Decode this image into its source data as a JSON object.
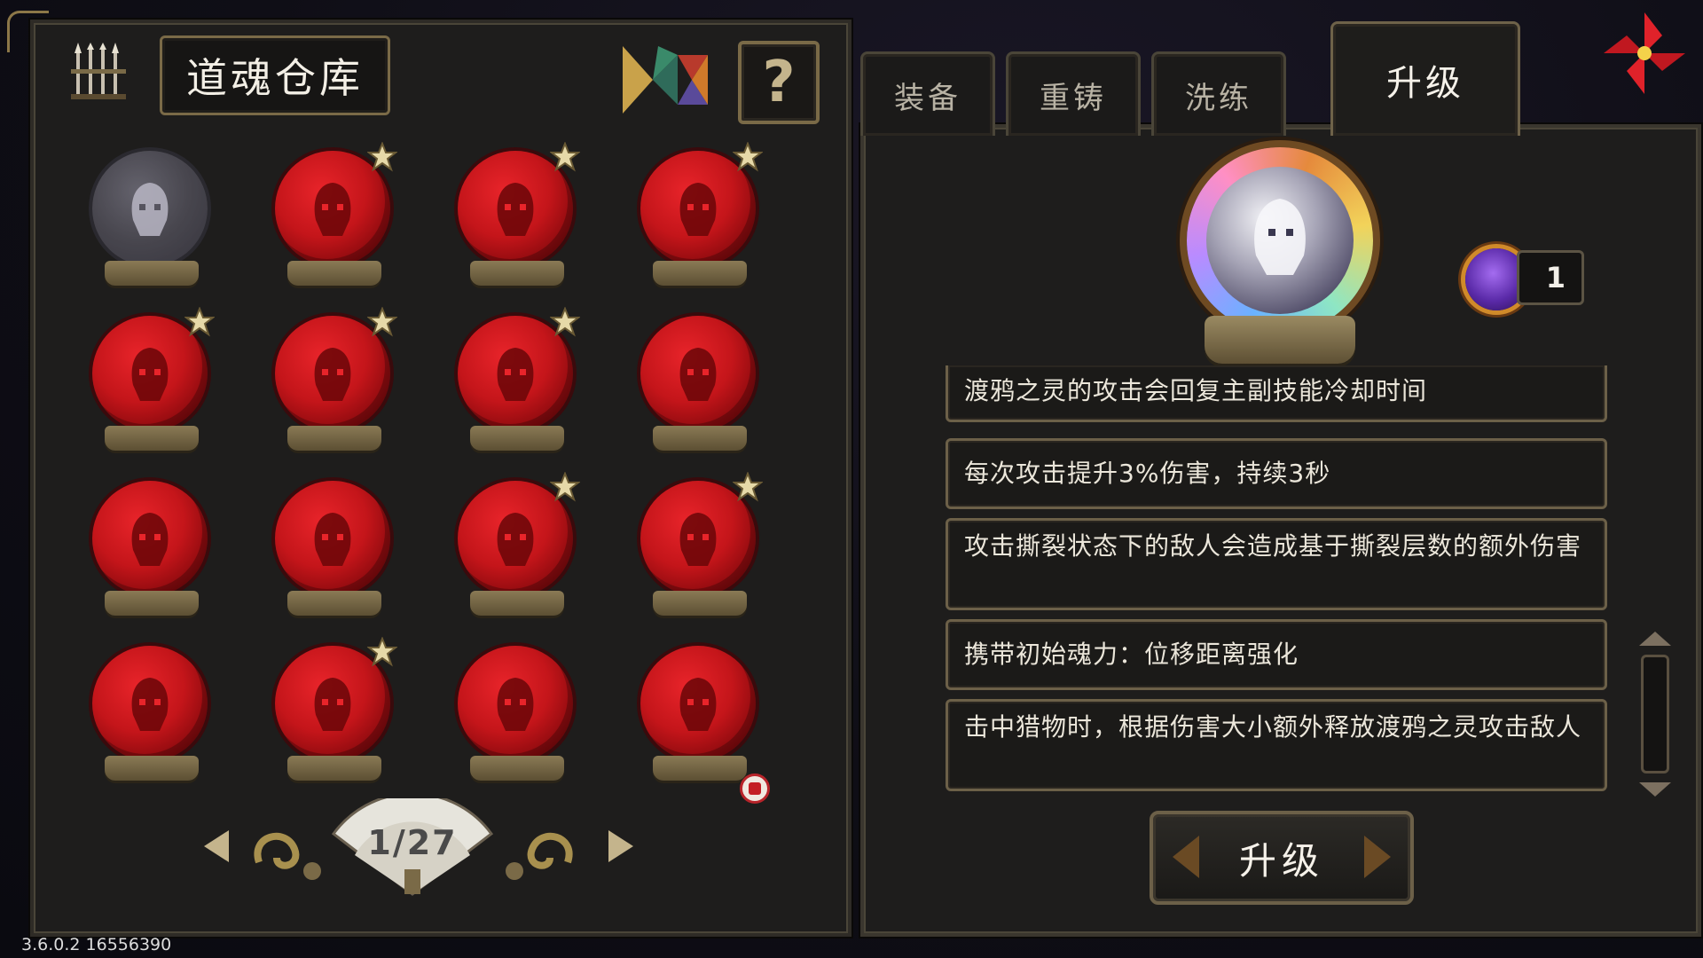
{
  "left": {
    "title": "道魂仓库",
    "help_label": "?",
    "orbs": [
      {
        "state": "locked",
        "starred": false
      },
      {
        "state": "owned",
        "starred": true
      },
      {
        "state": "owned",
        "starred": true
      },
      {
        "state": "owned",
        "starred": true
      },
      {
        "state": "owned",
        "starred": true
      },
      {
        "state": "owned",
        "starred": true
      },
      {
        "state": "owned",
        "starred": true
      },
      {
        "state": "owned",
        "starred": false
      },
      {
        "state": "owned",
        "starred": false
      },
      {
        "state": "owned",
        "starred": false
      },
      {
        "state": "owned",
        "starred": true
      },
      {
        "state": "owned",
        "starred": true
      },
      {
        "state": "owned",
        "starred": false
      },
      {
        "state": "owned",
        "starred": true
      },
      {
        "state": "owned",
        "starred": false
      },
      {
        "state": "owned",
        "starred": false
      }
    ],
    "page": "1/27"
  },
  "tabs": [
    {
      "label": "装备",
      "active": false
    },
    {
      "label": "重铸",
      "active": false
    },
    {
      "label": "洗练",
      "active": false
    },
    {
      "label": "升级",
      "active": true
    }
  ],
  "right": {
    "cost_count": "1",
    "descriptions": [
      "渡鸦之灵的攻击会回复主副技能冷却时间",
      "每次攻击提升3%伤害，持续3秒",
      "攻击撕裂状态下的敌人会造成基于撕裂层数的额外伤害",
      "携带初始魂力：位移距离强化",
      "击中猎物时，根据伤害大小额外释放渡鸦之灵攻击敌人"
    ],
    "upgrade_label": "升级"
  },
  "version": "3.6.0.2 16556390",
  "colors": {
    "orb_red": "#c4151a",
    "frame_gold": "#7a6a47",
    "panel_bg": "#1e1d1c",
    "close_red": "#d01820"
  },
  "icons": {
    "title": "weapon-rack-icon",
    "tangram": "tangram-icon",
    "close": "red-pinwheel-close-icon",
    "cost": "purple-soul-gem-icon"
  }
}
